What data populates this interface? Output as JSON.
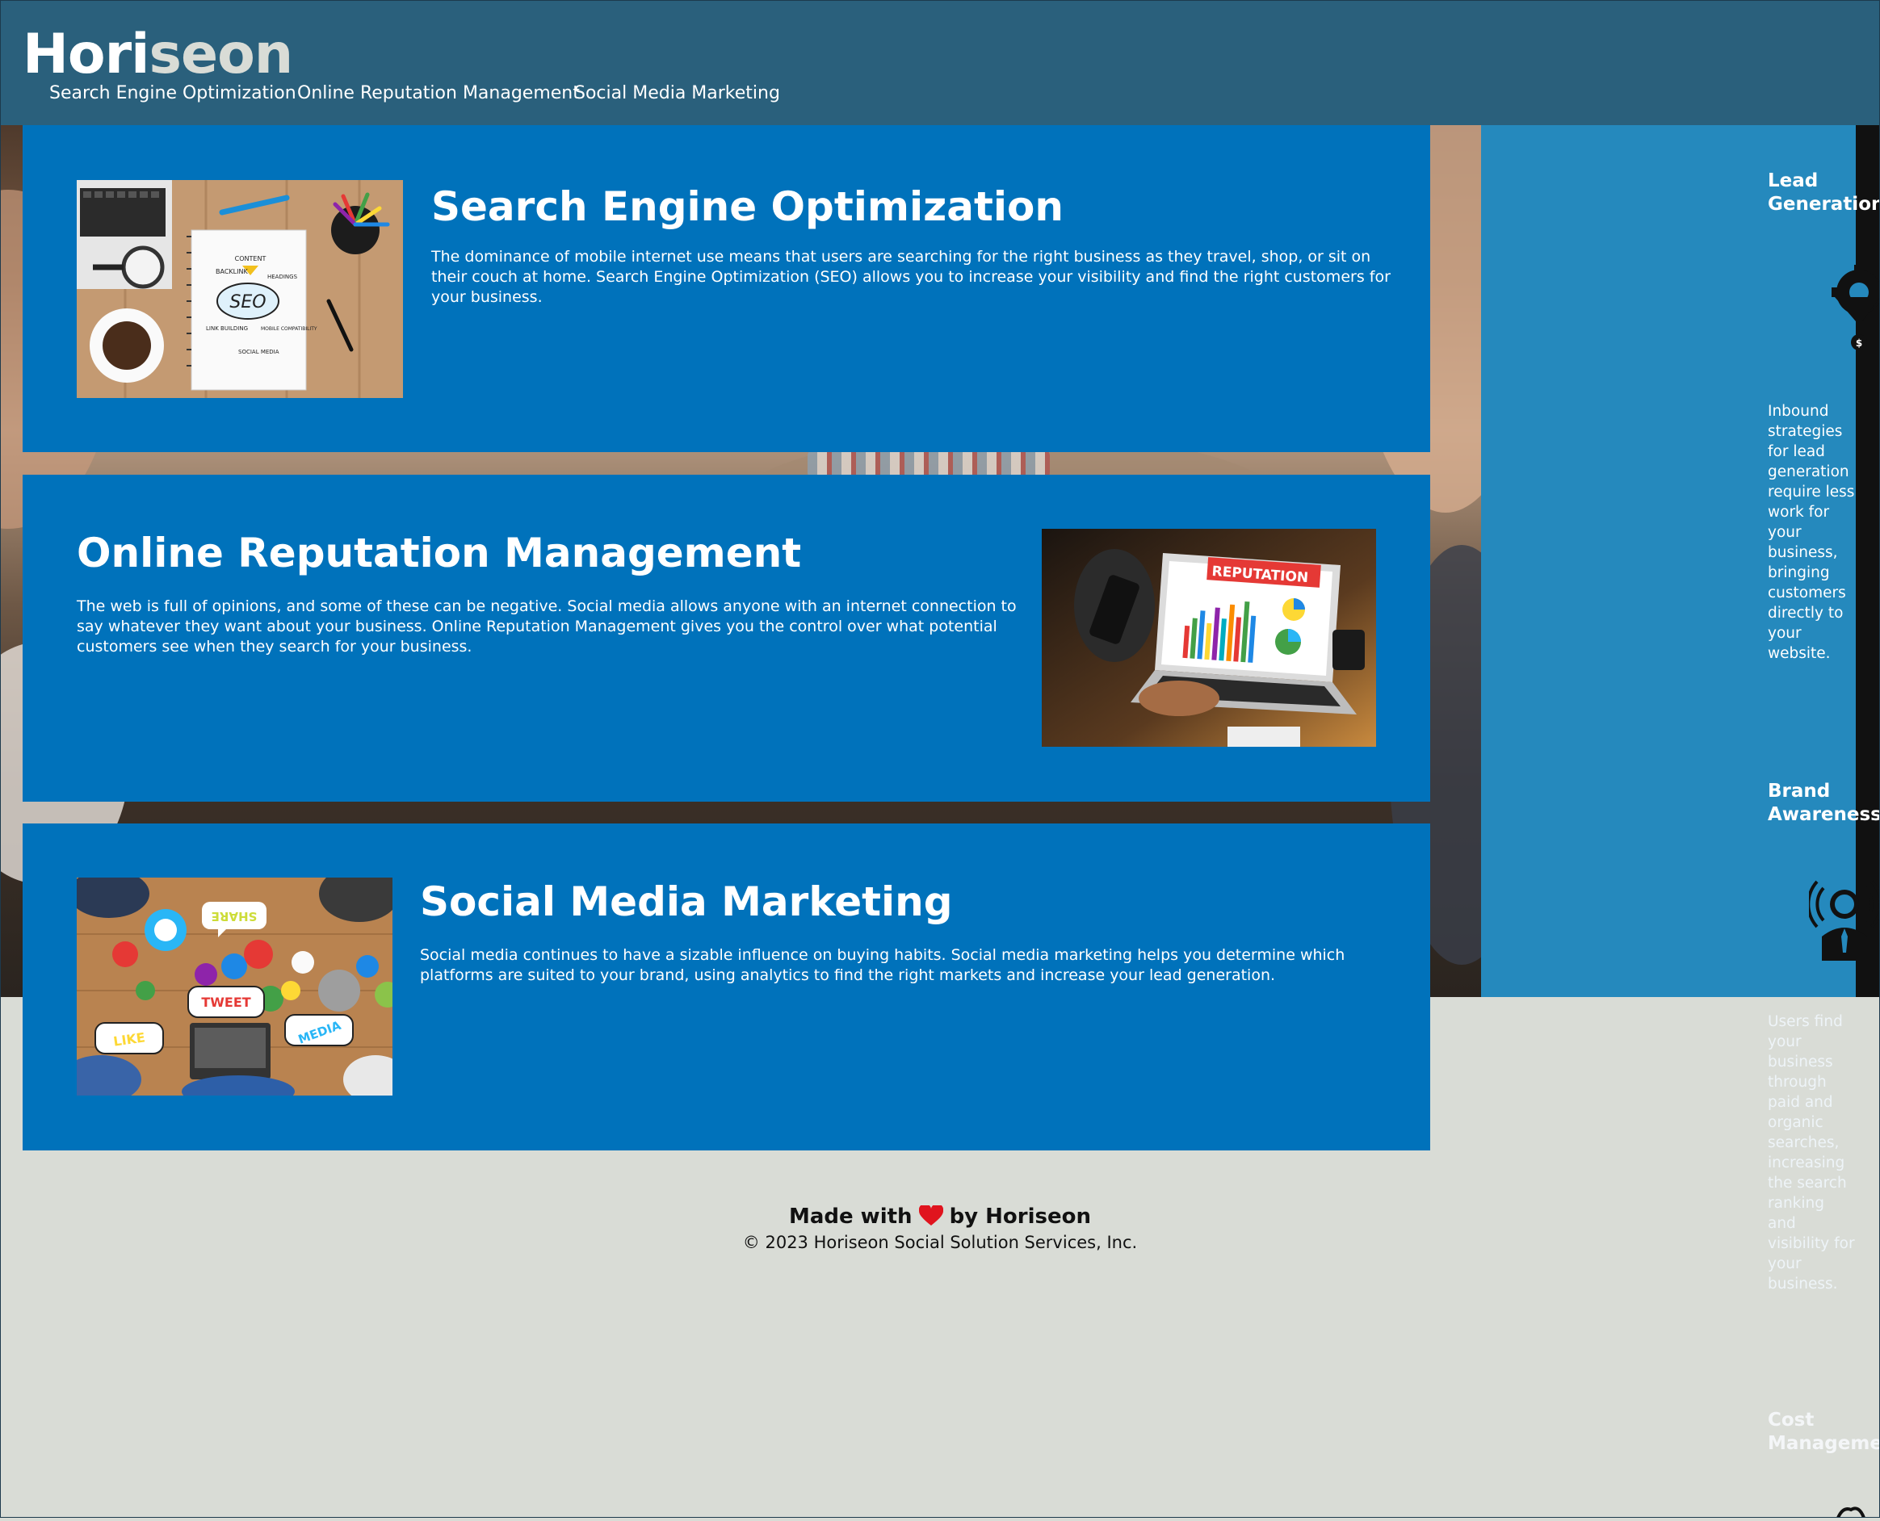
{
  "header": {
    "logo_part1": "Hori",
    "logo_part2": "seon",
    "nav": [
      {
        "label": "Search Engine Optimization"
      },
      {
        "label": "Online Reputation Management"
      },
      {
        "label": "Social Media Marketing"
      }
    ]
  },
  "content": [
    {
      "title": "Search Engine Optimization",
      "body": "The dominance of mobile internet use means that users are searching for the right business as they travel, shop, or sit on their couch at home. Search Engine Optimization (SEO) allows you to increase your visibility and find the right customers for your business.",
      "image_labels": [
        "CONTENT",
        "BACKLINK",
        "HEADINGS",
        "SEO",
        "LINK BUILDING",
        "MOBILE COMPATIBILITY",
        "SOCIAL MEDIA"
      ]
    },
    {
      "title": "Online Reputation Management",
      "body": "The web is full of opinions, and some of these can be negative. Social media allows anyone with an internet connection to say whatever they want about your business. Online Reputation Management gives you the control over what potential customers see when they search for your business.",
      "image_labels": [
        "REPUTATION"
      ]
    },
    {
      "title": "Social Media Marketing",
      "body": "Social media continues to have a sizable influence on buying habits. Social media marketing helps you determine which platforms are suited to your brand, using analytics to find the right markets and increase your lead generation.",
      "image_labels": [
        "SHARE",
        "TWEET",
        "LIKE",
        "MEDIA"
      ]
    }
  ],
  "sidebar": [
    {
      "title": "Lead Generation",
      "body": "Inbound strategies for lead generation require less work for your business, bringing customers directly to your website.",
      "icon": "funnel-gear-icon"
    },
    {
      "title": "Brand Awareness",
      "body": "Users find your business through paid and organic searches, increasing the search ranking and visibility for your business.",
      "icon": "broadcast-person-icon"
    },
    {
      "title": "Cost Management",
      "body": "",
      "icon": "cost-icon"
    }
  ],
  "footer": {
    "made_with": "Made with",
    "by": "by Horiseon",
    "copyright": "© 2023 Horiseon Social Solution Services, Inc."
  },
  "colors": {
    "header_bg": "#2a607c",
    "card_bg": "#0072bb",
    "aside_bg": "#2589bd",
    "page_bg": "#d9dcd6",
    "logo_accent": "#d9dcd6"
  }
}
